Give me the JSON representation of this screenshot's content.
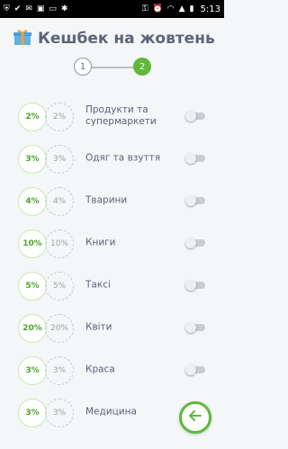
{
  "statusbar": {
    "time": "5:13",
    "left_icons": [
      "shield-icon",
      "check-icon",
      "mail-icon",
      "box-icon",
      "card-icon",
      "bug-icon"
    ],
    "right_icons": [
      "key-icon",
      "alarm-icon",
      "wifi-icon",
      "signal-icon",
      "battery-icon"
    ]
  },
  "header": {
    "title": "Кешбек на жовтень",
    "icon": "gift-icon",
    "icon_colors": {
      "box": "#5fb2e6",
      "ribbon": "#f0a23a"
    }
  },
  "stepper": {
    "steps": [
      {
        "label": "1",
        "state": "done"
      },
      {
        "label": "2",
        "state": "active"
      }
    ],
    "active_color": "#5fb83a"
  },
  "categories": [
    {
      "percent": "2%",
      "percent_secondary": "2%",
      "label": "Продукти та супермаркети",
      "enabled": false
    },
    {
      "percent": "3%",
      "percent_secondary": "3%",
      "label": "Одяг та взуття",
      "enabled": false
    },
    {
      "percent": "4%",
      "percent_secondary": "4%",
      "label": "Тварини",
      "enabled": false
    },
    {
      "percent": "10%",
      "percent_secondary": "10%",
      "label": "Книги",
      "enabled": false
    },
    {
      "percent": "5%",
      "percent_secondary": "5%",
      "label": "Таксі",
      "enabled": false
    },
    {
      "percent": "20%",
      "percent_secondary": "20%",
      "label": "Квіти",
      "enabled": false
    },
    {
      "percent": "3%",
      "percent_secondary": "3%",
      "label": "Краса",
      "enabled": false
    },
    {
      "percent": "3%",
      "percent_secondary": "3%",
      "label": "Медицина",
      "enabled": false
    }
  ],
  "fab": {
    "icon": "arrow-left-icon",
    "color": "#5fb83a"
  },
  "colors": {
    "accent": "#5fb83a",
    "text": "#5a6275",
    "background": "#f5f6f8"
  }
}
